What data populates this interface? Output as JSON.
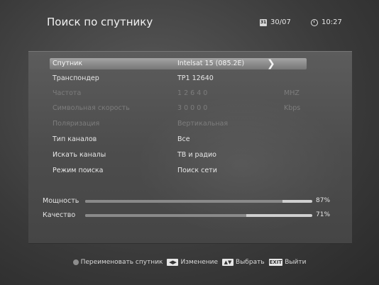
{
  "header": {
    "title": "Поиск по спутнику",
    "date": "30/07",
    "time": "10:27"
  },
  "rows": [
    {
      "label": "Спутник",
      "value": "Intelsat 15 (085.2E)",
      "unit": "",
      "state": "selected"
    },
    {
      "label": "Транспондер",
      "value": "TP1  12640",
      "unit": "",
      "state": "normal"
    },
    {
      "label": "Частота",
      "value": "1 2 6 4 0",
      "unit": "MHZ",
      "state": "disabled"
    },
    {
      "label": "Символьная скорость",
      "value": "3 0 0 0 0",
      "unit": "Kbps",
      "state": "disabled"
    },
    {
      "label": "Поляризация",
      "value": "Вертикальная",
      "unit": "",
      "state": "disabled"
    },
    {
      "label": "Тип каналов",
      "value": "Все",
      "unit": "",
      "state": "normal"
    },
    {
      "label": "Искать каналы",
      "value": "ТВ и радио",
      "unit": "",
      "state": "normal"
    },
    {
      "label": "Режим поиска",
      "value": "Поиск сети",
      "unit": "",
      "state": "normal"
    }
  ],
  "meters": {
    "power": {
      "label": "Мощность",
      "percent_text": "87%",
      "value": 87
    },
    "quality": {
      "label": "Качество",
      "percent_text": "71%",
      "value": 71
    }
  },
  "footer": {
    "rename": "Переименовать спутник",
    "change": "Изменение",
    "select": "Выбрать",
    "exit_key": "EXIT",
    "exit": "Выйти"
  },
  "icons": {
    "date": "calendar-icon",
    "time": "clock-icon",
    "rename": "green-dot-icon",
    "change": "left-right-key-icon",
    "select": "up-down-key-icon",
    "exit": "exit-key-icon"
  }
}
